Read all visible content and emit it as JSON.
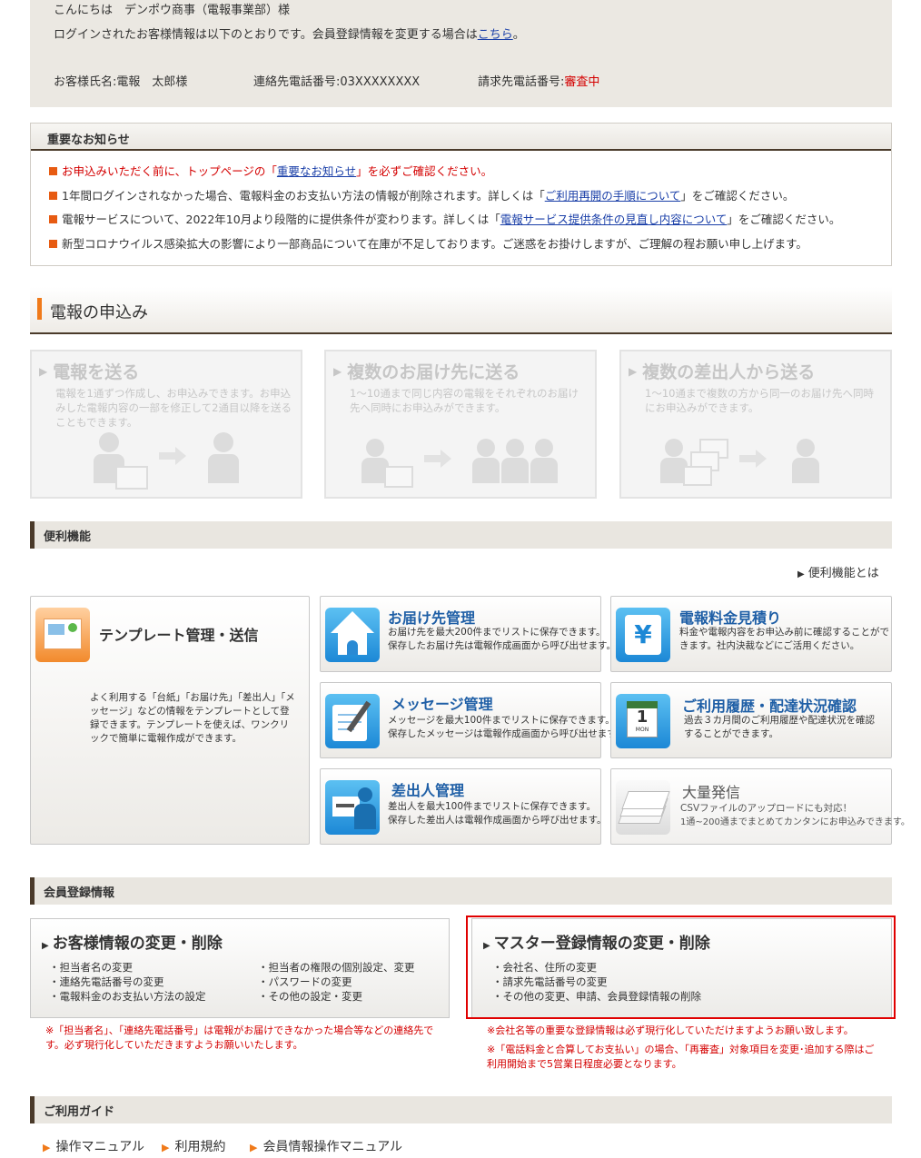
{
  "welcome": {
    "greeting": "こんにちは　デンポウ商事（電報事業部）様",
    "message": "ログインされたお客様情報は以下のとおりです。会員登録情報を変更する場合は",
    "link": "こちら",
    "message_end": "。",
    "customer_label": "お客様氏名:電報　太郎様",
    "phone_label": "連絡先電話番号:03XXXXXXXX",
    "billing_label": "請求先電話番号:",
    "billing_status": "審査中"
  },
  "notice": {
    "title": "重要なお知らせ",
    "items": [
      {
        "pre": "お申込みいただく前に、トップページの「",
        "link": "重要なお知らせ",
        "post": "」を必ずご確認ください。"
      },
      {
        "pre": "1年間ログインされなかった場合、電報料金のお支払い方法の情報が削除されます。詳しくは「",
        "link": "ご利用再開の手順について",
        "post": "」をご確認ください。"
      },
      {
        "pre": "電報サービスについて、2022年10月より段階的に提供条件が変わります。詳しくは「",
        "link": "電報サービス提供条件の見直し内容について",
        "post": "」をご確認ください。"
      },
      {
        "pre": "新型コロナウイルス感染拡大の影響により一部商品について在庫が不足しております。ご迷惑をお掛けしますが、ご理解の程お願い申し上げます。",
        "link": "",
        "post": ""
      }
    ]
  },
  "apply": {
    "title": "電報の申込み",
    "cards": [
      {
        "title": "電報を送る",
        "desc": "電報を1通ずつ作成し、お申込みできます。お申込みした電報内容の一部を修正して2通目以降を送ることもできます。"
      },
      {
        "title": "複数のお届け先に送る",
        "desc": "1～10通まで同じ内容の電報をそれぞれのお届け先へ同時にお申込みができます。"
      },
      {
        "title": "複数の差出人から送る",
        "desc": "1～10通まで複数の方から同一のお届け先へ同時にお申込みができます。"
      }
    ]
  },
  "features": {
    "title": "便利機能",
    "whatis": "便利機能とは",
    "template": {
      "title": "テンプレート管理・送信",
      "desc": "よく利用する「台紙」「お届け先」「差出人」「メッセージ」などの情報をテンプレートとして登録できます。テンプレートを使えば、ワンクリックで簡単に電報作成ができます。"
    },
    "items": [
      {
        "title": "お届け先管理",
        "desc1": "お届け先を最大200件までリストに保存できます。",
        "desc2": "保存したお届け先は電報作成画面から呼び出せます。"
      },
      {
        "title": "電報料金見積り",
        "desc1": "料金や電報内容をお申込み前に確認することがで",
        "desc2": "きます。社内決裁などにご活用ください。"
      },
      {
        "title": "メッセージ管理",
        "desc1": "メッセージを最大100件までリストに保存できます。",
        "desc2": "保存したメッセージは電報作成画面から呼び出せます。"
      },
      {
        "title": "ご利用履歴・配達状況確認",
        "desc1": "過去３カ月間のご利用履歴や配達状況を確認",
        "desc2": "することができます。"
      },
      {
        "title": "差出人管理",
        "desc1": "差出人を最大100件までリストに保存できます。",
        "desc2": "保存した差出人は電報作成画面から呼び出せます。"
      },
      {
        "title": "大量発信",
        "desc1": "CSVファイルのアップロードにも対応！",
        "desc2": "1通~200通までまとめてカンタンにお申込みできます。"
      }
    ],
    "calendar_day": "1",
    "calendar_mon": "MON",
    "yen": "¥"
  },
  "member": {
    "title": "会員登録情報",
    "customer": {
      "title": "お客様情報の変更・削除",
      "left": [
        "・担当者名の変更",
        "・連絡先電話番号の変更",
        "・電報料金のお支払い方法の設定"
      ],
      "right": [
        "・担当者の権限の個別設定、変更",
        "・パスワードの変更",
        "・その他の設定・変更"
      ]
    },
    "master": {
      "title": "マスター登録情報の変更・削除",
      "items": [
        "・会社名、住所の変更",
        "・請求先電話番号の変更",
        "・その他の変更、申請、会員登録情報の削除"
      ]
    },
    "note_left": "※「担当者名」、「連絡先電話番号」は電報がお届けできなかった場合等などの連絡先です。必ず現行化していただきますようお願いいたします。",
    "note_right1": "※会社名等の重要な登録情報は必ず現行化していただけますようお願い致します。",
    "note_right2": "※「電話料金と合算してお支払い」の場合、「再審査」対象項目を変更･追加する際はご利用開始まで5営業日程度必要となります。"
  },
  "guide": {
    "title": "ご利用ガイド",
    "links": [
      "操作マニュアル",
      "利用規約",
      "会員情報操作マニュアル"
    ]
  }
}
